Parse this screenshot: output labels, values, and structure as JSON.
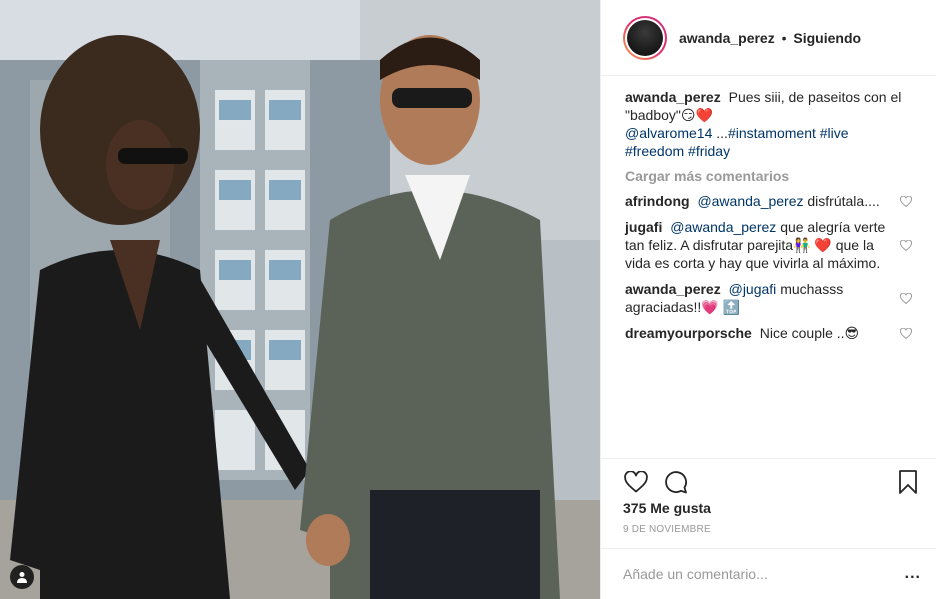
{
  "post": {
    "username": "awanda_perez",
    "follow_status": "Siguiendo",
    "separator": "•",
    "caption": {
      "user": "awanda_perez",
      "text": "Pues siii, de paseitos con el \"badboy\"😏❤️",
      "mention": "@alvarome14",
      "ellipsis": " ...",
      "tags": [
        "#instamoment",
        "#live",
        "#freedom",
        "#friday"
      ]
    },
    "load_more_label": "Cargar más comentarios",
    "comments": [
      {
        "user": "afrindong",
        "mention": "@awanda_perez",
        "text": "disfrútala...."
      },
      {
        "user": "jugafi",
        "mention": "@awanda_perez",
        "text": "que alegría verte tan feliz. A disfrutar parejita👫 ❤️ que la vida es corta y hay que vivirla al máximo."
      },
      {
        "user": "awanda_perez",
        "mention": "@jugafi",
        "text": "muchasss agraciadas!!💗 🔝"
      },
      {
        "user": "dreamyourporsche",
        "mention": "",
        "text": "Nice couple ..😎"
      }
    ],
    "likes_label": "375 Me gusta",
    "date_label": "9 DE NOVIEMBRE",
    "add_comment_placeholder": "Añade un comentario...",
    "more_options": "...",
    "icons": {
      "like": "heart-outline-icon",
      "comment": "speech-bubble-icon",
      "save": "bookmark-icon",
      "tagged": "person-tag-icon",
      "comment_like": "small-heart-icon"
    }
  }
}
